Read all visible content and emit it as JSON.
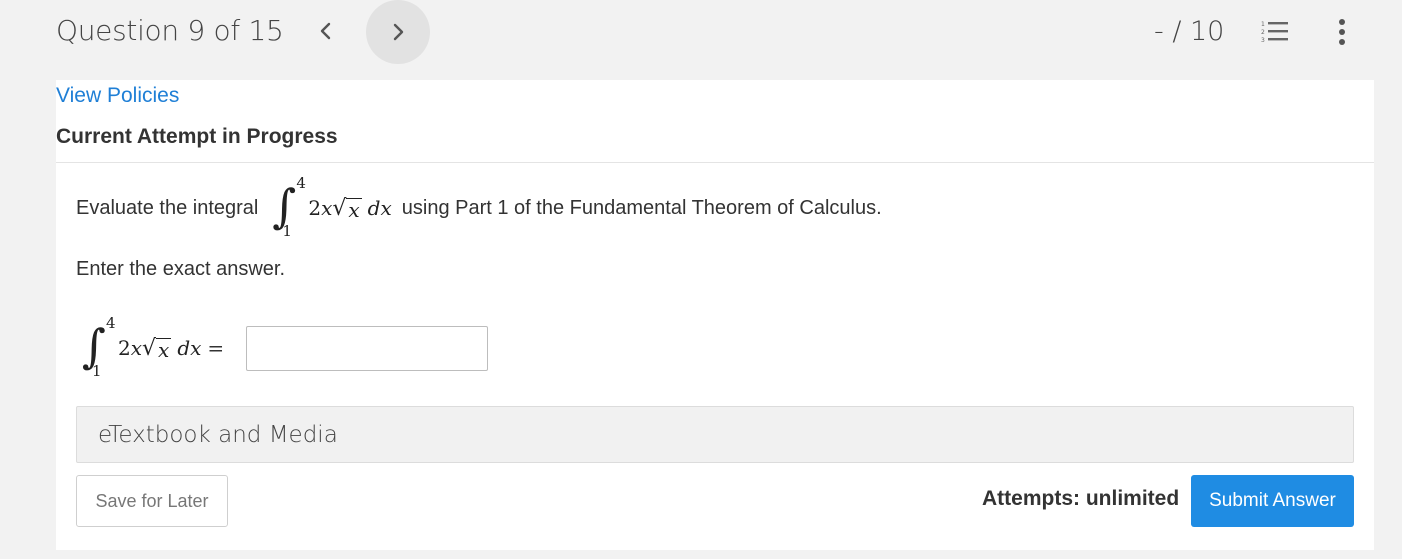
{
  "header": {
    "question_label": "Question 9 of 15",
    "score": "- / 10"
  },
  "icons": {
    "prev": "chevron-left-icon",
    "next": "chevron-right-icon",
    "list": "numbered-list-icon",
    "more": "vertical-dots-icon"
  },
  "card": {
    "policies_link": "View Policies",
    "attempt_title": "Current Attempt in Progress"
  },
  "question": {
    "prompt_before": "Evaluate the integral",
    "prompt_after": "using Part 1 of the Fundamental Theorem of Calculus.",
    "instructions": "Enter the exact answer.",
    "integral": {
      "upper": "4",
      "lower": "1",
      "coefficient": "2",
      "variable": "x",
      "radicand": "x",
      "differential": "dx"
    },
    "equals": "=",
    "answer_value": ""
  },
  "etextbook": {
    "label": "eTextbook and Media"
  },
  "footer": {
    "save_label": "Save for Later",
    "attempts_text": "Attempts: unlimited",
    "submit_label": "Submit Answer"
  },
  "colors": {
    "link": "#1f7fd6",
    "submit_bg": "#1f8ce3",
    "page_bg": "#f2f2f2"
  }
}
